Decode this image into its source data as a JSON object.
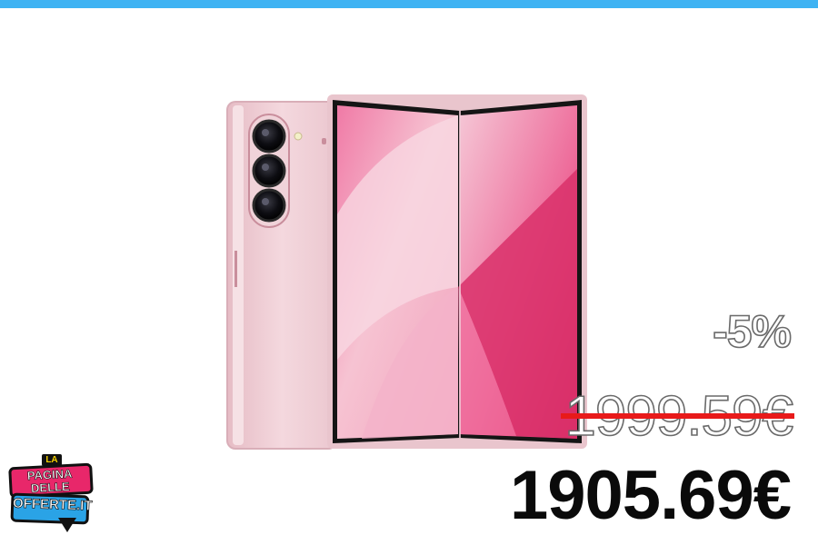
{
  "offer": {
    "discount": "-5%",
    "old_price": "1999.59€",
    "new_price": "1905.69€"
  },
  "logo": {
    "line1": "LA",
    "line2": "PAGINA DELLE",
    "line3": "OFFERTE.IT"
  },
  "colors": {
    "top_bar": "#3fb3f3",
    "strike": "#e81a1a",
    "phone_body": "#f1d2d8",
    "screen_pink": "#ec5f93"
  }
}
